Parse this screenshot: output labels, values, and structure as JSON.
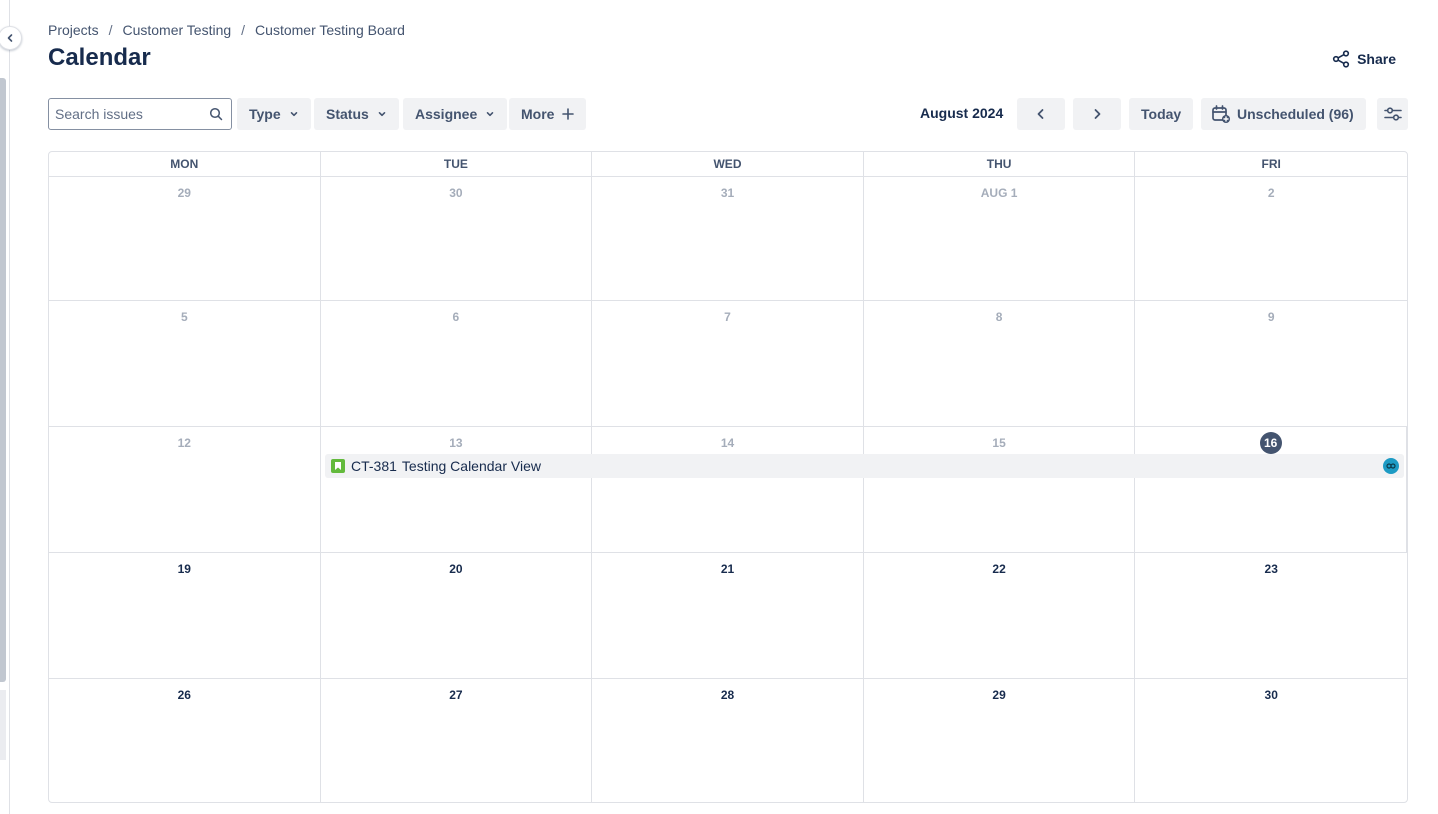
{
  "breadcrumb": [
    "Projects",
    "Customer Testing",
    "Customer Testing Board"
  ],
  "page": {
    "title": "Calendar",
    "share_label": "Share"
  },
  "toolbar": {
    "search_placeholder": "Search issues",
    "filters": [
      "Type",
      "Status",
      "Assignee"
    ],
    "more_label": "More",
    "month_label": "August 2024",
    "today_label": "Today",
    "unscheduled_label": "Unscheduled (96)"
  },
  "calendar": {
    "day_names": [
      "MON",
      "TUE",
      "WED",
      "THU",
      "FRI"
    ],
    "weeks": [
      [
        "29",
        "30",
        "31",
        "AUG 1",
        "2"
      ],
      [
        "5",
        "6",
        "7",
        "8",
        "9"
      ],
      [
        "12",
        "13",
        "14",
        "15",
        "16"
      ],
      [
        "19",
        "20",
        "21",
        "22",
        "23"
      ],
      [
        "26",
        "27",
        "28",
        "29",
        "30"
      ]
    ],
    "today": "16",
    "event": {
      "key": "CT-381",
      "summary": "Testing Calendar View",
      "issue_type_icon": "story-icon",
      "color": "#63ba3c"
    }
  },
  "colors": {
    "today_badge": "#44546f",
    "event_bg": "#f1f2f4",
    "avatar": "#1d9bc4"
  }
}
